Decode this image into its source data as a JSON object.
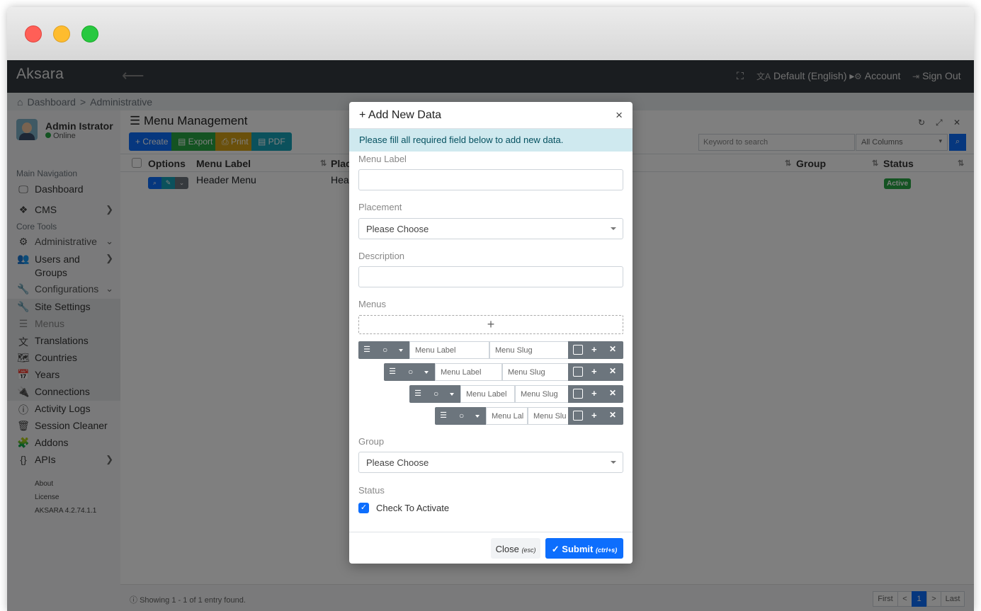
{
  "app": {
    "brand": "Aksara",
    "back_icon": "arrow-left-icon",
    "nav": {
      "fullscreen_icon": "fullscreen-icon",
      "language": "Default (English)",
      "account": "Account",
      "sign_out": "Sign Out"
    },
    "breadcrumb": [
      "Dashboard",
      ">",
      "Administrative"
    ]
  },
  "sidebar": {
    "user_name": "Admin Istrator",
    "user_status": "Online",
    "sections": [
      "Main Navigation",
      "Core Tools"
    ],
    "items": [
      {
        "label": "Dashboard",
        "icon": "monitor-icon"
      },
      {
        "label": "CMS",
        "icon": "dropbox-icon"
      },
      {
        "label": "Administrative",
        "icon": "cogs-icon"
      },
      {
        "label": "Users and Groups",
        "icon": "users-icon"
      },
      {
        "label": "Configurations",
        "icon": "wrench-icon"
      },
      {
        "label": "Site Settings",
        "icon": "wrench-icon"
      },
      {
        "label": "Menus",
        "icon": "menu-icon"
      },
      {
        "label": "Translations",
        "icon": "translate-icon"
      },
      {
        "label": "Countries",
        "icon": "map-icon"
      },
      {
        "label": "Years",
        "icon": "calendar-icon"
      },
      {
        "label": "Connections",
        "icon": "plug-icon"
      },
      {
        "label": "Activity Logs",
        "icon": "info-icon"
      },
      {
        "label": "Session Cleaner",
        "icon": "trash-icon"
      },
      {
        "label": "Addons",
        "icon": "puzzle-icon"
      },
      {
        "label": "APIs",
        "icon": "braces-icon"
      }
    ],
    "footer": [
      "About",
      "License",
      "AKSARA 4.2.74.1.1"
    ]
  },
  "main": {
    "title": "Menu Management",
    "toolbar": {
      "create": "Create",
      "export": "Export",
      "print": "Print",
      "pdf": "PDF",
      "search_placeholder": "Keyword to search",
      "column_select": "All Columns"
    },
    "table": {
      "columns": [
        "Options",
        "Menu Label",
        "Placement",
        "Group",
        "Status"
      ],
      "placement_visible": "Place",
      "rows": [
        {
          "menu_label": "Header Menu",
          "placement": "Head",
          "status": "Active"
        }
      ]
    },
    "footer": {
      "showing": "Showing 1 - 1 of 1 entry found.",
      "pagination": [
        "First",
        "<",
        "1",
        ">",
        "Last"
      ]
    }
  },
  "modal": {
    "title": "Add New Data",
    "alert": "Please fill all required field below to add new data.",
    "fields": {
      "menu_label": "Menu Label",
      "placement": "Placement",
      "placement_value": "Please Choose",
      "description": "Description",
      "menus": "Menus",
      "group": "Group",
      "group_value": "Please Choose",
      "status": "Status",
      "status_check": "Check To Activate"
    },
    "menu_rows": [
      {
        "label_placeholder": "Menu Label",
        "slug_placeholder": "Menu Slug"
      },
      {
        "label_placeholder": "Menu Label",
        "slug_placeholder": "Menu Slug"
      },
      {
        "label_placeholder": "Menu Label",
        "slug_placeholder": "Menu Slug"
      },
      {
        "label_placeholder": "Menu Lal",
        "slug_placeholder": "Menu Slu"
      }
    ],
    "buttons": {
      "close": "Close",
      "close_hint": "(esc)",
      "submit": "Submit",
      "submit_hint": "(ctrl+s)"
    }
  },
  "colors": {
    "navbar": "#343a40",
    "primary": "#0d6efd",
    "success": "#28a745",
    "warning": "#d4a017",
    "info": "#17a2b8",
    "alert_bg": "#cfe9ef"
  }
}
